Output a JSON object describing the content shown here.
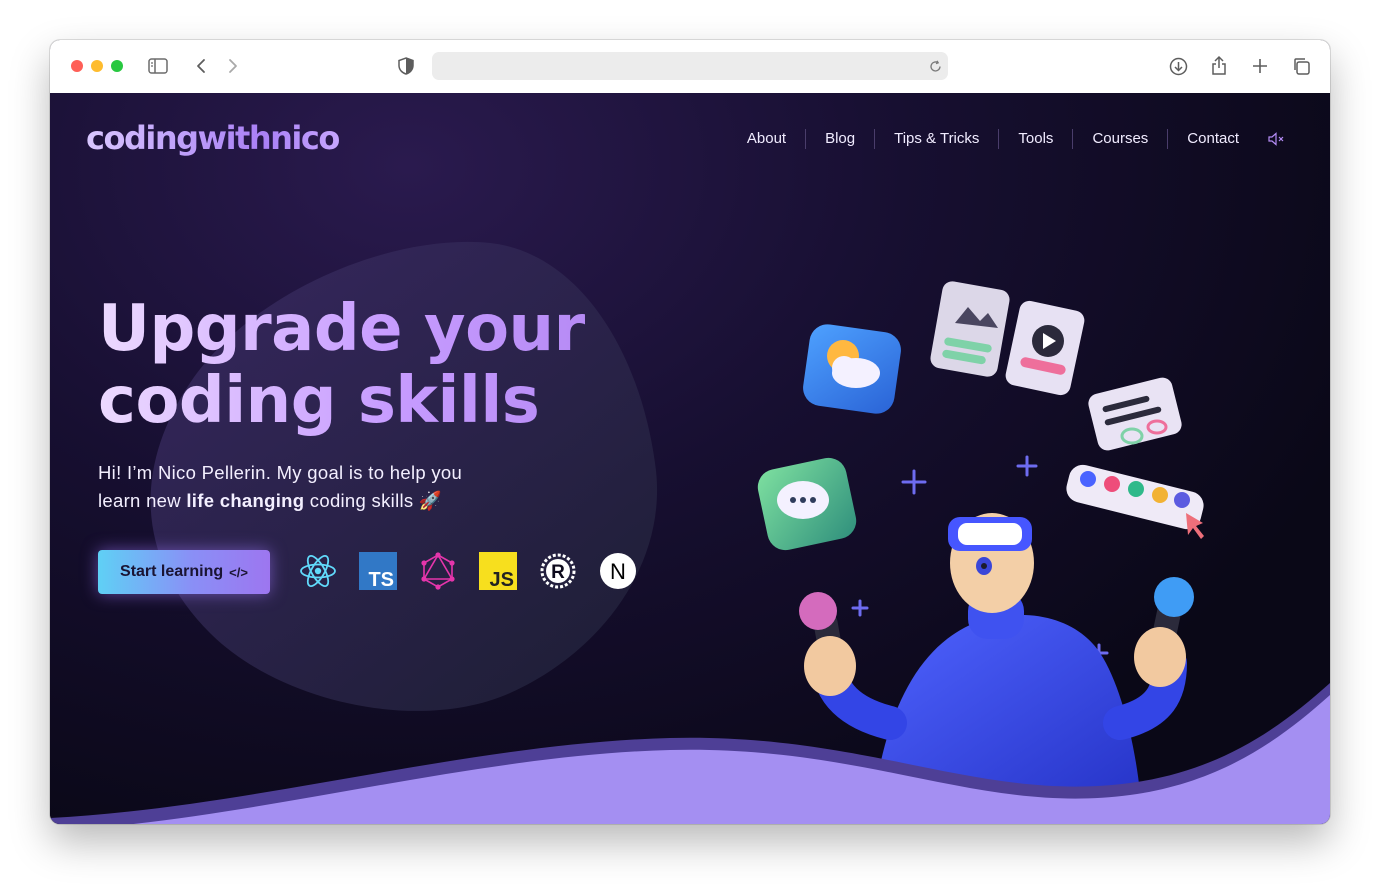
{
  "browser": {
    "traffic_lights": {
      "close": "#fe5f57",
      "minimize": "#febc2e",
      "zoom": "#28c840"
    },
    "icons": [
      "sidebar-icon",
      "back-icon",
      "forward-icon",
      "shield-icon",
      "reload-icon",
      "download-icon",
      "share-icon",
      "new-tab-icon",
      "tabs-overview-icon"
    ]
  },
  "site": {
    "logo": "codingwithnico",
    "nav": [
      "About",
      "Blog",
      "Tips & Tricks",
      "Tools",
      "Courses",
      "Contact"
    ],
    "mute_icon": "speaker-muted-icon"
  },
  "hero": {
    "headline_line1": "Upgrade your",
    "headline_line2": "coding skills",
    "intro_part1": "Hi! I’m Nico Pellerin. My goal is to help you",
    "intro_part2_before": "learn new ",
    "intro_highlight": "life changing",
    "intro_part2_after": " coding skills",
    "intro_emoji": "🚀",
    "cta_label": "Start learning",
    "cta_icon": "</>"
  },
  "tech_stack": [
    {
      "name": "react-icon",
      "color": "#61dafb"
    },
    {
      "name": "typescript-icon",
      "label": "TS",
      "color": "#3178c6"
    },
    {
      "name": "graphql-icon",
      "color": "#e535ab"
    },
    {
      "name": "javascript-icon",
      "label": "JS",
      "color": "#f7df1e"
    },
    {
      "name": "rust-icon",
      "label": "R",
      "color": "#ffffff"
    },
    {
      "name": "nextjs-icon",
      "label": "N",
      "color": "#ffffff"
    }
  ],
  "colors": {
    "accent_purple": "#a48ff2",
    "background_dark": "#0d0a1c",
    "headline_gradient_start": "#ecd9ff",
    "headline_gradient_end": "#b68bf5"
  }
}
